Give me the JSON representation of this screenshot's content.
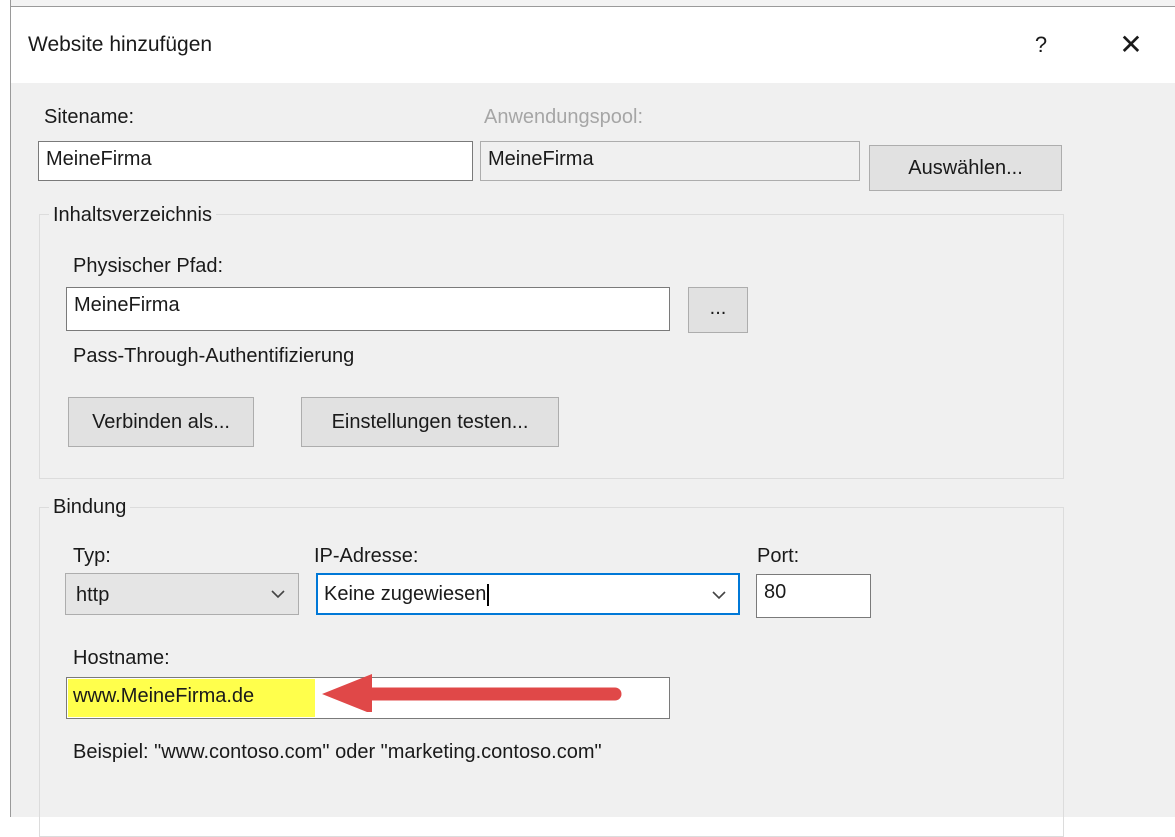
{
  "window": {
    "title": "Website hinzufügen",
    "help": "?",
    "close": "✕"
  },
  "site": {
    "sitename_label": "Sitename:",
    "sitename_value": "MeineFirma",
    "apppool_label": "Anwendungspool:",
    "apppool_value": "MeineFirma",
    "select_button": "Auswählen..."
  },
  "content_dir": {
    "legend": "Inhaltsverzeichnis",
    "path_label": "Physischer Pfad:",
    "path_value": "MeineFirma",
    "browse_button": "...",
    "passthrough_label": "Pass-Through-Authentifizierung",
    "connect_as_button": "Verbinden als...",
    "test_settings_button": "Einstellungen testen..."
  },
  "binding": {
    "legend": "Bindung",
    "type_label": "Typ:",
    "type_value": "http",
    "ip_label": "IP-Adresse:",
    "ip_value": "Keine zugewiesen",
    "port_label": "Port:",
    "port_value": "80",
    "hostname_label": "Hostname:",
    "hostname_value": "www.MeineFirma.de",
    "example_text": "Beispiel: \"www.contoso.com\" oder \"marketing.contoso.com\""
  },
  "colors": {
    "highlight": "#ffff4c",
    "arrow": "#e04848",
    "focus_border": "#0078d7"
  },
  "icons": {
    "dropdown": "chevron-down-icon"
  }
}
